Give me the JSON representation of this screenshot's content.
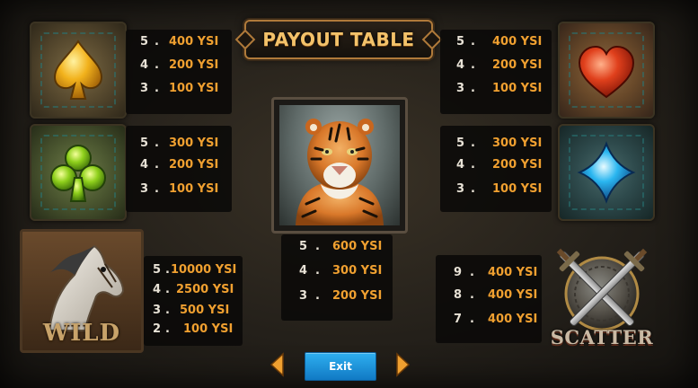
{
  "title": "PAYOUT TABLE",
  "currency": "YSI",
  "symbols": {
    "spade": {
      "icon": "spade-icon",
      "color": "#f2b21c",
      "pays": [
        {
          "count": "5",
          "value": "400 YSI"
        },
        {
          "count": "4",
          "value": "200 YSI"
        },
        {
          "count": "3",
          "value": "100 YSI"
        }
      ]
    },
    "club": {
      "icon": "club-icon",
      "color": "#8fd01c",
      "pays": [
        {
          "count": "5",
          "value": "300 YSI"
        },
        {
          "count": "4",
          "value": "200 YSI"
        },
        {
          "count": "3",
          "value": "100 YSI"
        }
      ]
    },
    "heart": {
      "icon": "heart-icon",
      "color": "#e0401c",
      "pays": [
        {
          "count": "5",
          "value": "400 YSI"
        },
        {
          "count": "4",
          "value": "200 YSI"
        },
        {
          "count": "3",
          "value": "100 YSI"
        }
      ]
    },
    "diamond": {
      "icon": "diamond-icon",
      "color": "#2ab6f0",
      "pays": [
        {
          "count": "5",
          "value": "300 YSI"
        },
        {
          "count": "4",
          "value": "200 YSI"
        },
        {
          "count": "3",
          "value": "100 YSI"
        }
      ]
    },
    "tiger": {
      "icon": "tiger-icon",
      "pays": [
        {
          "count": "5",
          "value": "600 YSI"
        },
        {
          "count": "4",
          "value": "300 YSI"
        },
        {
          "count": "3",
          "value": "200 YSI"
        }
      ]
    },
    "wild": {
      "icon": "horse-icon",
      "label": "WILD",
      "pays": [
        {
          "count": "5",
          "value": "10000 YSI"
        },
        {
          "count": "4",
          "value": "2500 YSI"
        },
        {
          "count": "3",
          "value": "500 YSI"
        },
        {
          "count": "2",
          "value": "100 YSI"
        }
      ]
    },
    "scatter": {
      "icon": "crossed-swords-icon",
      "label": "SCATTER",
      "pays": [
        {
          "count": "9",
          "value": "400 YSI"
        },
        {
          "count": "8",
          "value": "400 YSI"
        },
        {
          "count": "7",
          "value": "400 YSI"
        }
      ]
    }
  },
  "nav": {
    "exit_label": "Exit",
    "prev_icon": "chevron-left-icon",
    "next_icon": "chevron-right-icon",
    "arrow_color": "#f0a030",
    "exit_color": "#1f98e0"
  }
}
